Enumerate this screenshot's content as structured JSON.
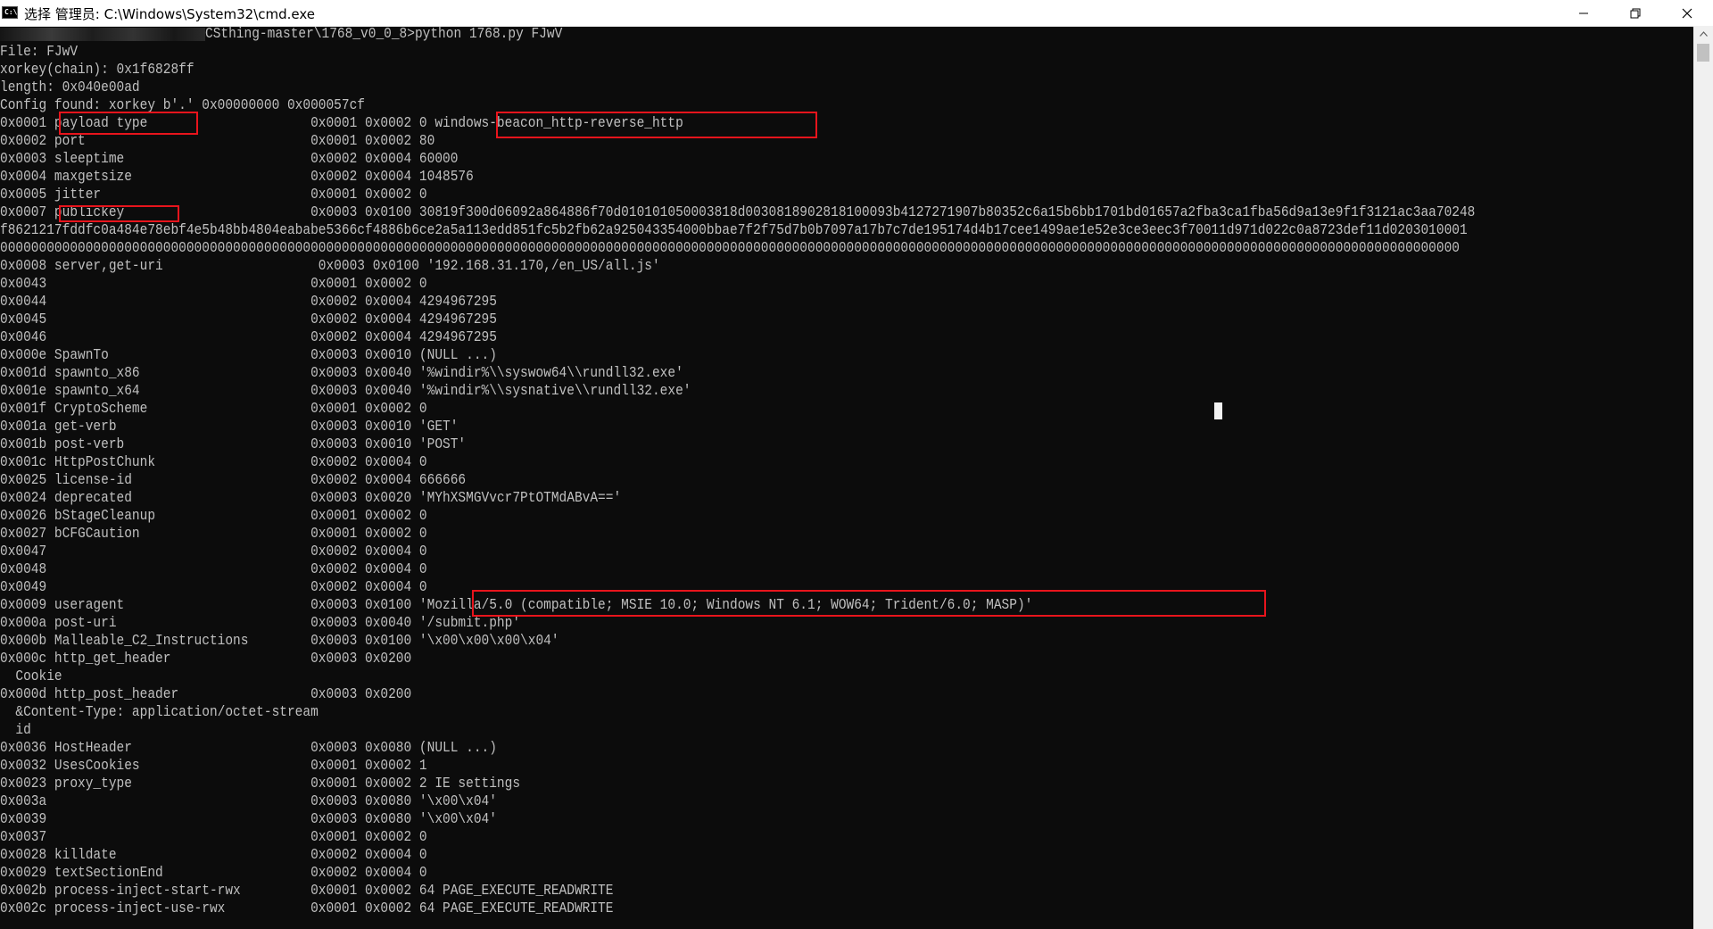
{
  "window": {
    "title": "选择 管理员: C:\\Windows\\System32\\cmd.exe",
    "icon": "cmd-icon",
    "icon_text": "C:\\",
    "buttons": [
      "minimize-icon",
      "restore-icon",
      "close-icon"
    ]
  },
  "terminal": {
    "prompt_path_tail": "CSthing-master\\1768_v0_0_8>python 1768.py FJwV",
    "lines": [
      "File: FJwV",
      "xorkey(chain): 0x1f6828ff",
      "length: 0x040e00ad",
      "Config found: xorkey b'.' 0x00000000 0x000057cf",
      "0x0001 payload type                     0x0001 0x0002 0 windows-beacon_http-reverse_http",
      "0x0002 port                             0x0001 0x0002 80",
      "0x0003 sleeptime                        0x0002 0x0004 60000",
      "0x0004 maxgetsize                       0x0002 0x0004 1048576",
      "0x0005 jitter                           0x0001 0x0002 0",
      "0x0007 publickey                        0x0003 0x0100 30819f300d06092a864886f70d010101050003818d0030818902818100093b4127271907b80352c6a15b6bb1701bd01657a2fba3ca1fba56d9a13e9f1f3121ac3aa70248",
      "f8621217fddfc0a484e78ebf4e5b48bb4804eababe5366cf4886b6ce2a5a113edd851fc5b2fb62a925043354000bbae7f2f75d7b0b7097a17b7c7de195174d4b17cee1499ae1e52e3ce3eec3f70011d971d022c0a8723def11d0203010001",
      "00000000000000000000000000000000000000000000000000000000000000000000000000000000000000000000000000000000000000000000000000000000000000000000000000000000000000000000000000000000000000000000",
      "0x0008 server,get-uri                    0x0003 0x0100 '192.168.31.170,/en_US/all.js'",
      "0x0043                                  0x0001 0x0002 0",
      "0x0044                                  0x0002 0x0004 4294967295",
      "0x0045                                  0x0002 0x0004 4294967295",
      "0x0046                                  0x0002 0x0004 4294967295",
      "0x000e SpawnTo                          0x0003 0x0010 (NULL ...)",
      "0x001d spawnto_x86                      0x0003 0x0040 '%windir%\\\\syswow64\\\\rundll32.exe'",
      "0x001e spawnto_x64                      0x0003 0x0040 '%windir%\\\\sysnative\\\\rundll32.exe'",
      "0x001f CryptoScheme                     0x0001 0x0002 0",
      "0x001a get-verb                         0x0003 0x0010 'GET'",
      "0x001b post-verb                        0x0003 0x0010 'POST'",
      "0x001c HttpPostChunk                    0x0002 0x0004 0",
      "0x0025 license-id                       0x0002 0x0004 666666",
      "0x0024 deprecated                       0x0003 0x0020 'MYhXSMGVvcr7PtOTMdABvA=='",
      "0x0026 bStageCleanup                    0x0001 0x0002 0",
      "0x0027 bCFGCaution                      0x0001 0x0002 0",
      "0x0047                                  0x0002 0x0004 0",
      "0x0048                                  0x0002 0x0004 0",
      "0x0049                                  0x0002 0x0004 0",
      "0x0009 useragent                        0x0003 0x0100 'Mozilla/5.0 (compatible; MSIE 10.0; Windows NT 6.1; WOW64; Trident/6.0; MASP)'",
      "0x000a post-uri                         0x0003 0x0040 '/submit.php'",
      "0x000b Malleable_C2_Instructions        0x0003 0x0100 '\\x00\\x00\\x00\\x04'",
      "0x000c http_get_header                  0x0003 0x0200",
      "  Cookie",
      "0x000d http_post_header                 0x0003 0x0200",
      "  &Content-Type: application/octet-stream",
      "  id",
      "0x0036 HostHeader                       0x0003 0x0080 (NULL ...)",
      "0x0032 UsesCookies                      0x0001 0x0002 1",
      "0x0023 proxy_type                       0x0001 0x0002 2 IE settings",
      "0x003a                                  0x0003 0x0080 '\\x00\\x04'",
      "0x0039                                  0x0003 0x0080 '\\x00\\x04'",
      "0x0037                                  0x0001 0x0002 0",
      "0x0028 killdate                         0x0002 0x0004 0",
      "0x0029 textSectionEnd                   0x0002 0x0004 0",
      "0x002b process-inject-start-rwx         0x0001 0x0002 64 PAGE_EXECUTE_READWRITE",
      "0x002c process-inject-use-rwx           0x0001 0x0002 64 PAGE_EXECUTE_READWRITE"
    ]
  },
  "highlight_color": "#e8141c",
  "text_color": "#c0c0c0",
  "background_color": "#0c0c0c"
}
